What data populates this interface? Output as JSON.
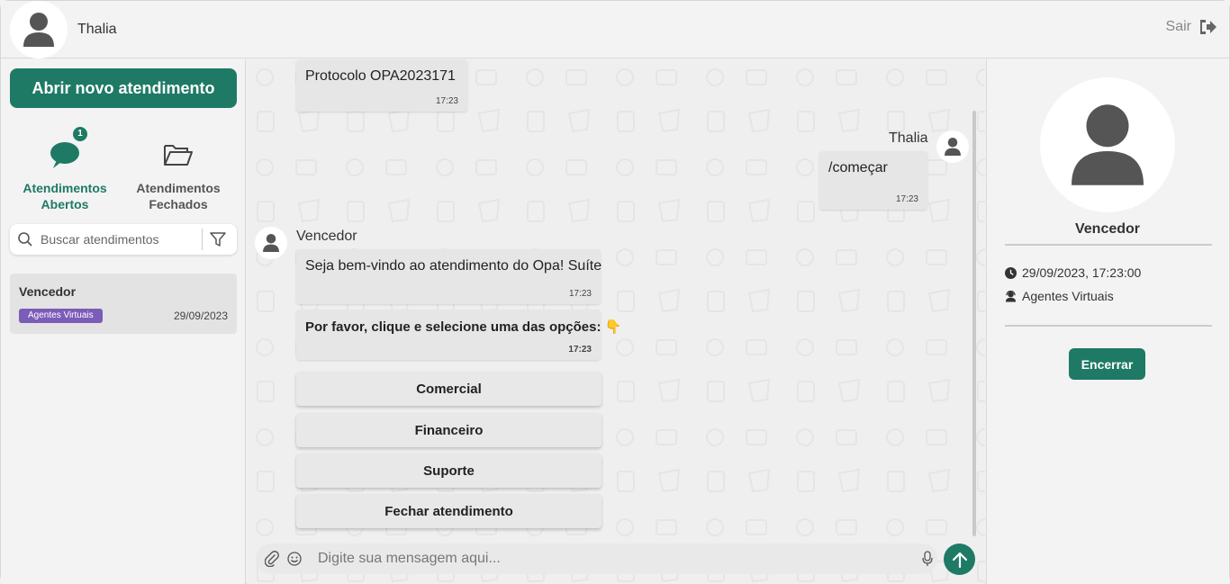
{
  "header": {
    "username": "Thalia",
    "logout_label": "Sair"
  },
  "sidebar": {
    "new_button_label": "Abrir novo atendimento",
    "tabs": [
      {
        "label_line1": "Atendimentos",
        "label_line2": "Abertos",
        "badge": "1",
        "active": true
      },
      {
        "label_line1": "Atendimentos",
        "label_line2": "Fechados",
        "active": false
      }
    ],
    "search_placeholder": "Buscar atendimentos",
    "conversations": [
      {
        "name": "Vencedor",
        "tag": "Agentes Virtuais",
        "date": "29/09/2023"
      }
    ]
  },
  "chat": {
    "messages": [
      {
        "text": "Protocolo OPA2023171",
        "time": "17:23"
      },
      {
        "sender": "Thalia",
        "text": "/começar",
        "time": "17:23"
      },
      {
        "sender": "Vencedor",
        "text": "Seja bem-vindo ao atendimento do Opa! Suíte",
        "time": "17:23"
      },
      {
        "text": "Por favor, clique e selecione uma das opções: 👇",
        "time": "17:23"
      }
    ],
    "options": [
      "Comercial",
      "Financeiro",
      "Suporte",
      "Fechar atendimento"
    ],
    "composer_placeholder": "Digite sua mensagem aqui..."
  },
  "contact_panel": {
    "name": "Vencedor",
    "datetime": "29/09/2023, 17:23:00",
    "department": "Agentes Virtuais",
    "end_button_label": "Encerrar"
  },
  "colors": {
    "accent": "#1e7a65",
    "tag": "#7b5cb8"
  }
}
